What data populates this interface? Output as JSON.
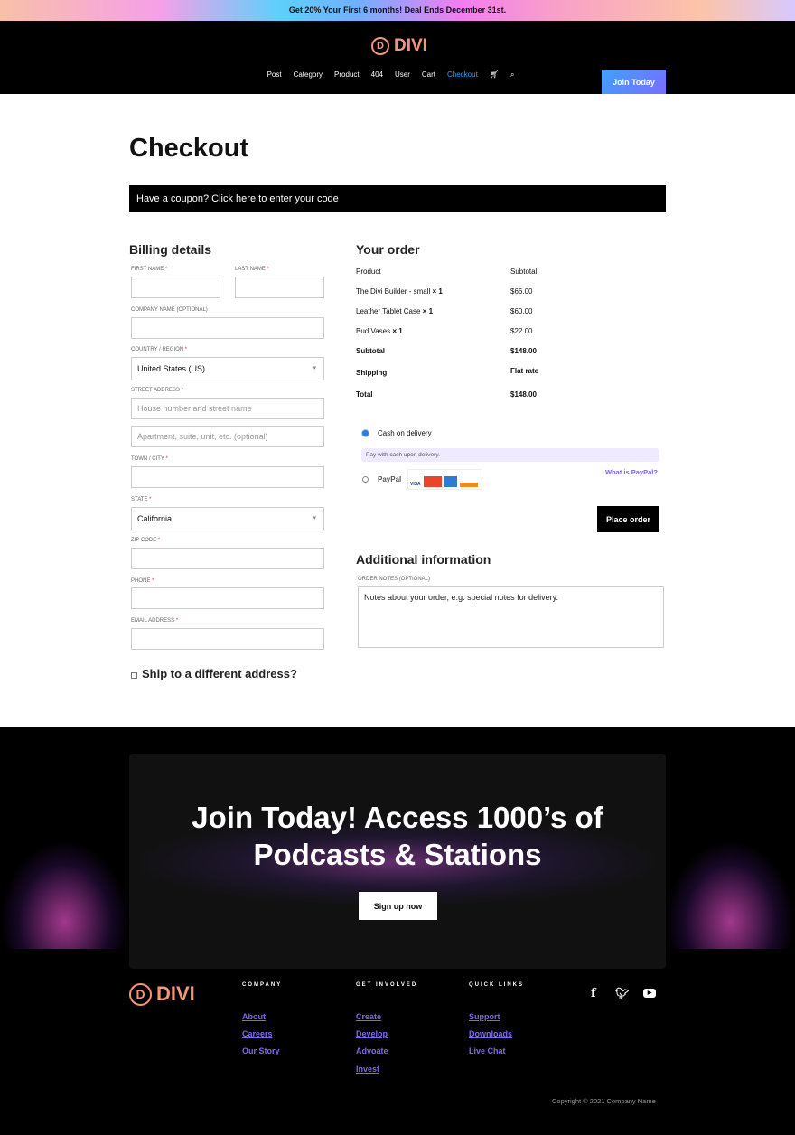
{
  "promo": "Get 20% Your First 6 months! Deal Ends December 31st.",
  "brand": {
    "letter": "D",
    "name": "DIVI",
    "color": "#f3957b"
  },
  "nav": [
    "Post",
    "Category",
    "Product",
    "404",
    "User",
    "Cart",
    "Checkout"
  ],
  "join_button": "Join Today",
  "page_title": "Checkout",
  "coupon": "Have a coupon? Click here to enter your code",
  "billing": {
    "title": "Billing details",
    "first_name": "FIRST NAME",
    "last_name": "LAST NAME",
    "company": "COMPANY NAME (OPTIONAL)",
    "country": "COUNTRY / REGION",
    "country_value": "United States (US)",
    "street": "STREET ADDRESS",
    "street_ph1": "House number and street name",
    "street_ph2": "Apartment, suite, unit, etc. (optional)",
    "town": "TOWN / CITY",
    "state": "STATE",
    "state_value": "California",
    "zip": "ZIP CODE",
    "phone": "PHONE",
    "email": "EMAIL ADDRESS",
    "required": "*",
    "ship_diff": "Ship to a different address?"
  },
  "order": {
    "title": "Your order",
    "col_product": "Product",
    "col_subtotal": "Subtotal",
    "items": [
      {
        "name": "The Divi Builder - small",
        "qty": "× 1",
        "price": "$66.00"
      },
      {
        "name": "Leather Tablet Case",
        "qty": "× 1",
        "price": "$60.00"
      },
      {
        "name": "Bud Vases",
        "qty": "× 1",
        "price": "$22.00"
      }
    ],
    "subtotal_label": "Subtotal",
    "subtotal": "$148.00",
    "shipping_label": "Shipping",
    "shipping": "Flat rate",
    "total_label": "Total",
    "total": "$148.00"
  },
  "payment": {
    "cod": "Cash on delivery",
    "cod_desc": "Pay with cash upon delivery.",
    "paypal": "PayPal",
    "what_paypal": "What is PayPal?",
    "selected": "cod"
  },
  "place_order": "Place order",
  "additional": {
    "title": "Additional information",
    "notes_label": "ORDER NOTES (OPTIONAL)",
    "notes_placeholder": "Notes about your order, e.g. special notes for delivery."
  },
  "cta": {
    "heading": "Join Today! Access 1000’s of Podcasts & Stations",
    "button": "Sign up now"
  },
  "footer": {
    "cols": [
      {
        "title": "COMPANY",
        "links": [
          "About",
          "Careers",
          "Our Story"
        ]
      },
      {
        "title": "GET INVOLVED",
        "links": [
          "Create",
          "Develop",
          "Advoate",
          "Invest"
        ]
      },
      {
        "title": "QUICK LINKS",
        "links": [
          "Support",
          "Downloads",
          "Live Chat"
        ]
      }
    ],
    "social": [
      "facebook-icon",
      "twitter-icon",
      "youtube-icon"
    ],
    "copyright": "Copyright © 2021 Company Name"
  }
}
